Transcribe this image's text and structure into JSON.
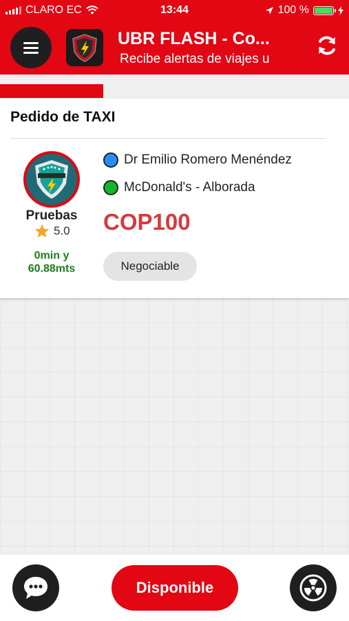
{
  "status_bar": {
    "carrier": "CLARO EC",
    "time": "13:44",
    "battery": "100 %",
    "battery_color": "#4cd964"
  },
  "header": {
    "title": "UBR FLASH - Co...",
    "subtitle": "Recibe alertas de viajes u",
    "menu_icon": "hamburger-menu-icon",
    "refresh_icon": "refresh-icon",
    "logo_text": "UBR FLASH",
    "brand_color": "#e30613"
  },
  "progress": {
    "fraction": 0.295
  },
  "card": {
    "title": "Pedido de TAXI",
    "driver": {
      "name": "Pruebas",
      "rating": "5.0",
      "eta_line1": "0min y",
      "eta_line2": "60.88mts"
    },
    "origin": {
      "label": "Dr Emilio Romero Menéndez",
      "dot_color": "#2a8cf4"
    },
    "destination": {
      "label": "McDonald's - Alborada",
      "dot_color": "#11b82a"
    },
    "price": "COP100",
    "negotiable_label": "Negociable"
  },
  "bottom": {
    "chat_icon": "chat-bubble-icon",
    "main_button_label": "Disponible",
    "radio_icon": "radiation-icon"
  }
}
